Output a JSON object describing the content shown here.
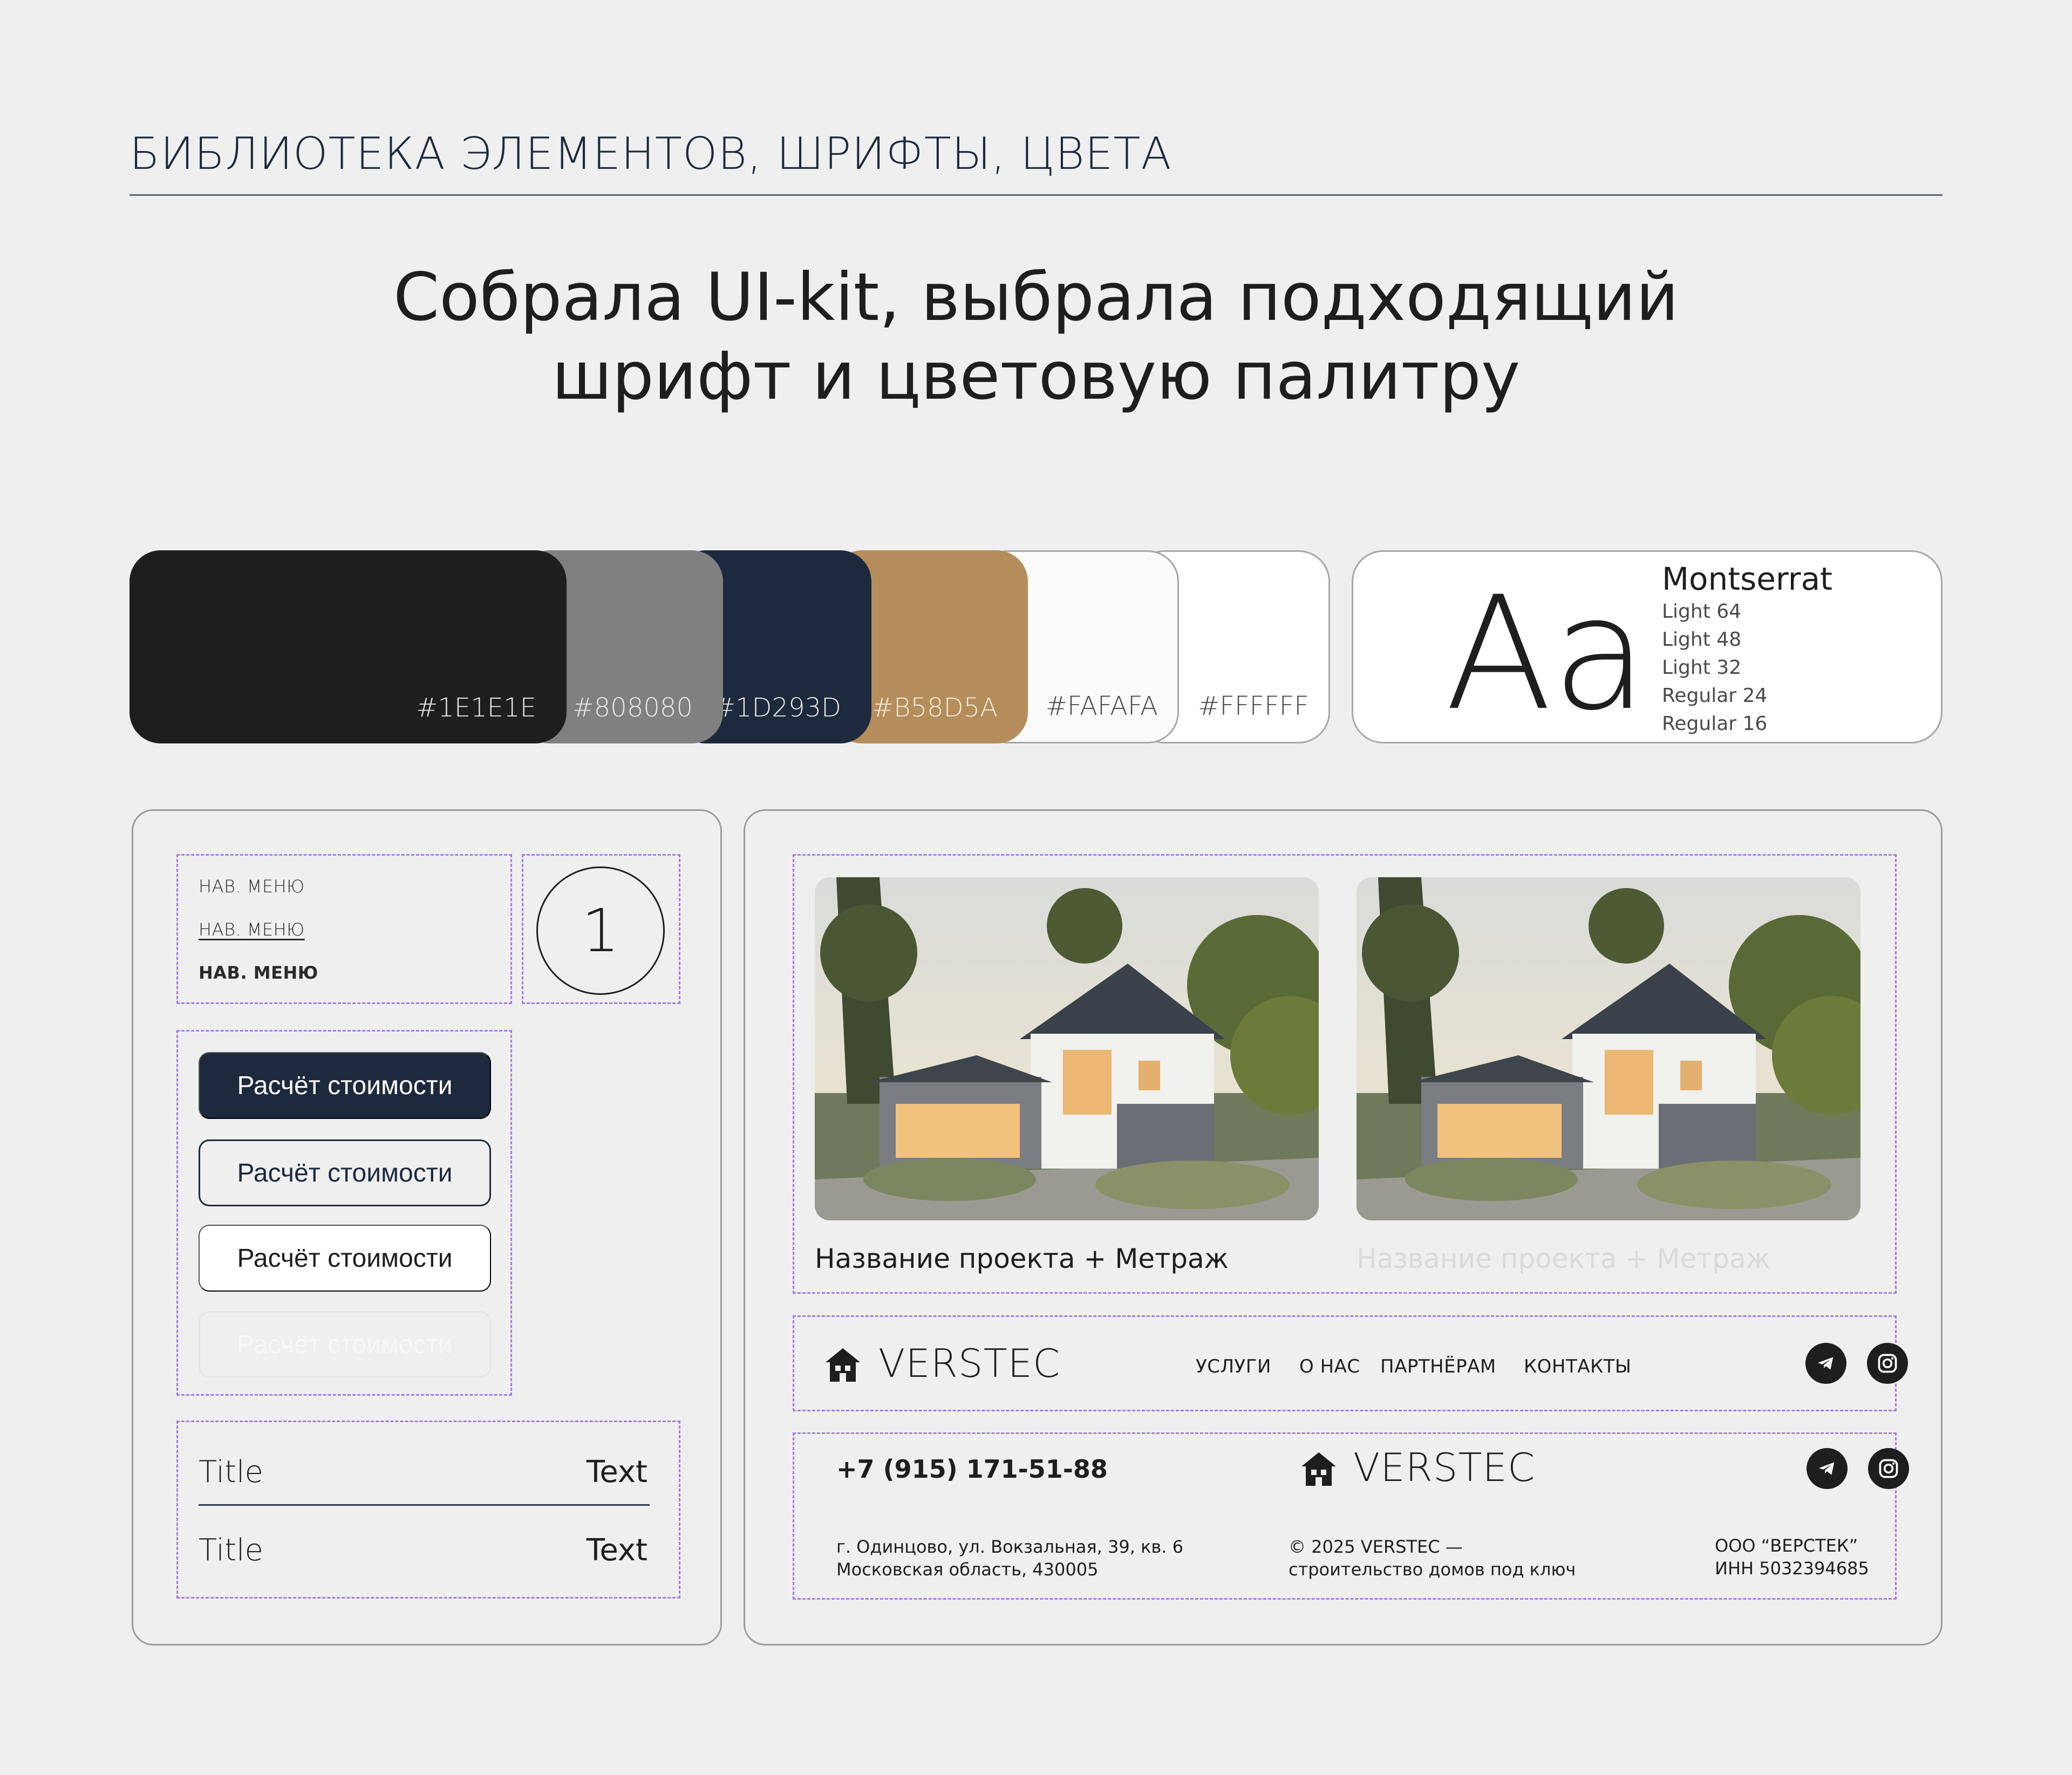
{
  "header": {
    "section_title": "БИБЛИОТЕКА ЭЛЕМЕНТОВ, ШРИФТЫ, ЦВЕТА",
    "headline": "Собрала UI-kit, выбрала подходящий шрифт и цветовую палитру"
  },
  "palette": [
    {
      "label": "#1E1E1E",
      "color": "#1E1E1E"
    },
    {
      "label": "#808080",
      "color": "#808080"
    },
    {
      "label": "#1D293D",
      "color": "#1D293D"
    },
    {
      "label": "#B58D5A",
      "color": "#B58D5A"
    },
    {
      "label": "#FAFAFA",
      "color": "#FAFAFA"
    },
    {
      "label": "#FFFFFF",
      "color": "#FFFFFF"
    }
  ],
  "font_card": {
    "sample": "Aa",
    "name": "Montserrat",
    "weights": [
      "Light 64",
      "Light 48",
      "Light 32",
      "Regular 24",
      "Regular 16"
    ]
  },
  "nav_menu": {
    "items": [
      "НАВ. МЕНЮ",
      "НАВ. МЕНЮ",
      "НАВ. МЕНЮ"
    ],
    "states": [
      "default",
      "hover-underline",
      "active-bold"
    ]
  },
  "counter": {
    "value": "1"
  },
  "buttons": [
    {
      "label": "Расчёт стоимости",
      "variant": "primary"
    },
    {
      "label": "Расчёт стоимости",
      "variant": "outline"
    },
    {
      "label": "Расчёт стоимости",
      "variant": "white"
    },
    {
      "label": "Расчёт стоимости",
      "variant": "disabled"
    }
  ],
  "list": [
    {
      "title": "Title",
      "text": "Text"
    },
    {
      "title": "Title",
      "text": "Text"
    }
  ],
  "project_cards": [
    {
      "caption": "Название проекта + Метраж",
      "state": "active",
      "image": "house-photo"
    },
    {
      "caption": "Название проекта + Метраж",
      "state": "muted",
      "image": "house-photo"
    }
  ],
  "navbar": {
    "logo_text": "VERSTEC",
    "links": [
      "УСЛУГИ",
      "О НАС",
      "ПАРТНЁРАМ",
      "КОНТАКТЫ"
    ],
    "social": [
      "telegram-icon",
      "instagram-icon"
    ]
  },
  "footer": {
    "phone": "+7 (915) 171-51-88",
    "logo_text": "VERSTEC",
    "address_line1": "г. Одинцово, ул. Вокзальная, 39, кв. 6",
    "address_line2": "Московская область, 430005",
    "copyright_line1": "© 2025 VERSTEC —",
    "copyright_line2": "строительство домов под ключ",
    "legal_line1": "ООО “ВЕРСТЕК”",
    "legal_line2": "ИНН 5032394685"
  }
}
